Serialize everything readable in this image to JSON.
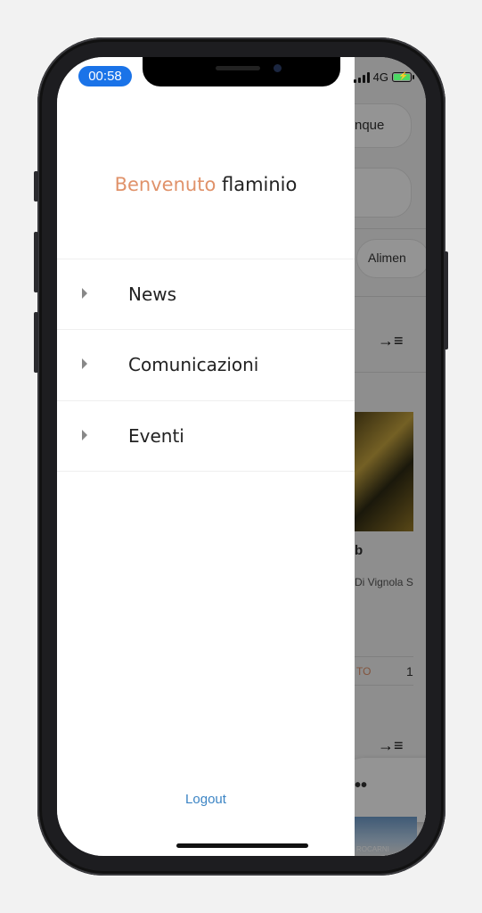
{
  "status_bar": {
    "time": "00:58",
    "network": "4G"
  },
  "drawer": {
    "welcome_prefix": "Benvenuto",
    "username": "flaminio",
    "menu": [
      {
        "label": "News"
      },
      {
        "label": "Comunicazioni"
      },
      {
        "label": "Eventi"
      }
    ],
    "logout_label": "Logout"
  },
  "background_app": {
    "search_partial": "nque",
    "category_partial": "Alimen",
    "card_title_partial": "b",
    "card_subtitle_partial": "Di Vignola S",
    "card_button_partial": "TO",
    "card_count_partial": "1",
    "banner_partial": "ROCARNI"
  },
  "colors": {
    "welcome_accent": "#e0926a",
    "logout_link": "#3b84c4",
    "time_pill": "#1a73e8",
    "battery_charging": "#4cd964"
  }
}
